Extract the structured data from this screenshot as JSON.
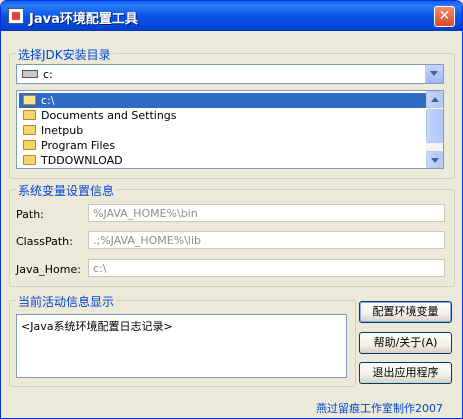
{
  "window": {
    "title": "Java环境配置工具",
    "close_glyph": "✕"
  },
  "jdk_section": {
    "legend": "选择JDK安装目录",
    "drive_value": "c:",
    "directories": [
      {
        "label": "c:\\",
        "selected": true
      },
      {
        "label": "Documents and Settings",
        "selected": false
      },
      {
        "label": "Inetpub",
        "selected": false
      },
      {
        "label": "Program Files",
        "selected": false
      },
      {
        "label": "TDDOWNLOAD",
        "selected": false
      }
    ]
  },
  "env_section": {
    "legend": "系统变量设置信息",
    "fields": [
      {
        "label": "Path:",
        "value": "%JAVA_HOME%\\bin"
      },
      {
        "label": "ClassPath:",
        "value": ".;%JAVA_HOME%\\lib"
      },
      {
        "label": "Java_Home:",
        "value": "c:\\"
      }
    ]
  },
  "activity_section": {
    "legend": "当前活动信息显示",
    "log_text": "<Java系统环境配置日志记录>"
  },
  "buttons": {
    "configure": "配置环境变量",
    "help": "帮助/关于(A)",
    "exit": "退出应用程序"
  },
  "footer": "燕过留痕工作室制作2007",
  "colors": {
    "accent": "#0046d5",
    "selection": "#316ac5"
  }
}
